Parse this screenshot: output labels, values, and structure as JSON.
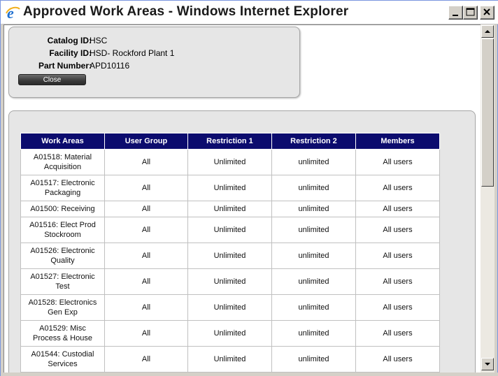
{
  "window": {
    "title": "Approved Work Areas - Windows Internet Explorer"
  },
  "info": {
    "catalog_label": "Catalog ID:",
    "catalog_value": "HSC",
    "facility_label": "Facility ID:",
    "facility_value": "HSD- Rockford Plant 1",
    "part_label": "Part Number:",
    "part_value": "APD10116",
    "close_label": "Close"
  },
  "table": {
    "headers": [
      "Work Areas",
      "User Group",
      "Restriction 1",
      "Restriction 2",
      "Members"
    ],
    "rows": [
      {
        "area": "A01518: Material Acquisition",
        "group": "All",
        "r1": "Unlimited",
        "r2": "unlimited",
        "members": "All users"
      },
      {
        "area": "A01517: Electronic Packaging",
        "group": "All",
        "r1": "Unlimited",
        "r2": "unlimited",
        "members": "All users"
      },
      {
        "area": "A01500: Receiving",
        "group": "All",
        "r1": "Unlimited",
        "r2": "unlimited",
        "members": "All users"
      },
      {
        "area": "A01516: Elect Prod Stockroom",
        "group": "All",
        "r1": "Unlimited",
        "r2": "unlimited",
        "members": "All users"
      },
      {
        "area": "A01526: Electronic Quality",
        "group": "All",
        "r1": "Unlimited",
        "r2": "unlimited",
        "members": "All users"
      },
      {
        "area": "A01527: Electronic Test",
        "group": "All",
        "r1": "Unlimited",
        "r2": "unlimited",
        "members": "All users"
      },
      {
        "area": "A01528: Electronics Gen Exp",
        "group": "All",
        "r1": "Unlimited",
        "r2": "unlimited",
        "members": "All users"
      },
      {
        "area": "A01529: Misc Process & House",
        "group": "All",
        "r1": "Unlimited",
        "r2": "unlimited",
        "members": "All users"
      },
      {
        "area": "A01544: Custodial Services",
        "group": "All",
        "r1": "Unlimited",
        "r2": "unlimited",
        "members": "All users"
      }
    ]
  },
  "icons": {
    "app": "ie-icon",
    "minimize": "minimize-icon",
    "maximize": "maximize-icon",
    "close": "close-icon",
    "scroll_up": "arrow-up-icon",
    "scroll_down": "arrow-down-icon"
  },
  "colors": {
    "header_bg": "#0c0c6e",
    "panel_bg": "#e6e6e6"
  }
}
